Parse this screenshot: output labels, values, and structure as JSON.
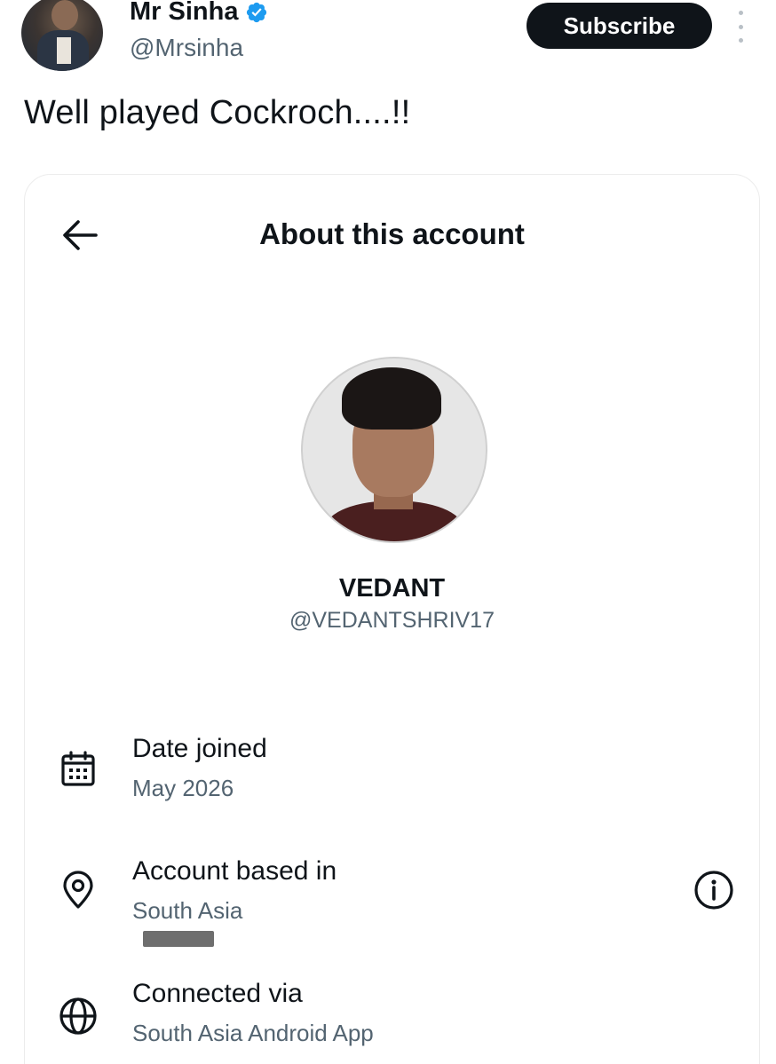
{
  "tweet": {
    "author_name": "Mr Sinha",
    "author_handle": "@Mrsinha",
    "subscribe_label": "Subscribe",
    "text": "Well played Cockroch....!!",
    "verified_color": "#1d9bf0"
  },
  "card": {
    "title": "About this account",
    "profile": {
      "name": "VEDANT",
      "handle": "@VEDANTSHRIV17"
    },
    "rows": [
      {
        "icon": "calendar-icon",
        "label": "Date joined",
        "value": "May 2026"
      },
      {
        "icon": "location-pin-icon",
        "label": "Account based in",
        "value": "South Asia",
        "action_icon": "info-icon"
      },
      {
        "icon": "globe-icon",
        "label": "Connected via",
        "value": "South Asia Android App"
      }
    ]
  },
  "colors": {
    "text_primary": "#0f1419",
    "text_secondary": "#536471",
    "button_dark": "#0f1419"
  }
}
